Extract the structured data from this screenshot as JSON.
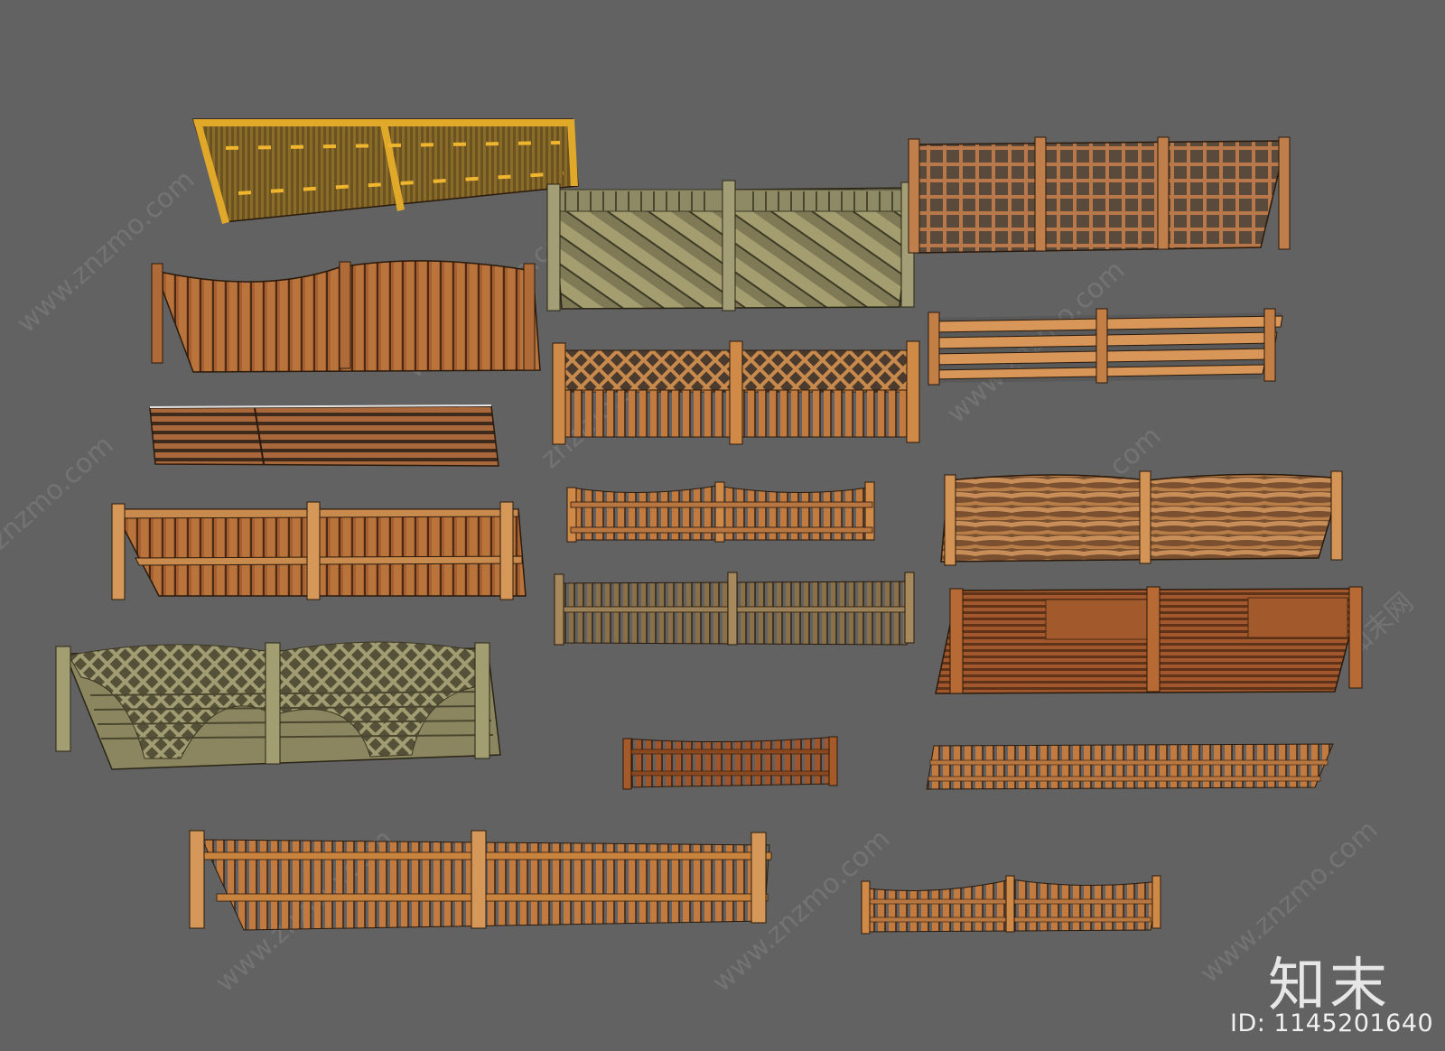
{
  "image": {
    "background": "#626262",
    "content": "sketchup-style collection of 18 wooden fence panel models"
  },
  "watermark": {
    "site_text": "znzmo.com",
    "site_text_www": "www.znzmo.com",
    "brand_text": "知末网",
    "logo_text": "知末",
    "id_text": "ID: 1145201640"
  },
  "colors": {
    "amber": "#c0862a",
    "amber_dark": "#8a5a1c",
    "orange_wood": "#c77a3a",
    "brown_wood": "#a35a28",
    "olive_wood": "#8c8660",
    "yellow_frame": "#e1a92a",
    "outline": "#2a1a0c"
  },
  "fences": [
    {
      "id": "bamboo-panel",
      "style": "vertical-slats-yellow-frame"
    },
    {
      "id": "diagonal-board",
      "style": "diagonal-boards-olive"
    },
    {
      "id": "square-lattice",
      "style": "grid-lattice"
    },
    {
      "id": "curved-top-vertical",
      "style": "vertical-boards-curved-top"
    },
    {
      "id": "lattice-top-picket",
      "style": "lattice-top-with-vertical-pickets"
    },
    {
      "id": "horizontal-rail",
      "style": "horizontal-rails"
    },
    {
      "id": "horizontal-slat",
      "style": "horizontal-slats"
    },
    {
      "id": "scalloped-picket",
      "style": "scalloped-pickets"
    },
    {
      "id": "woven-wood",
      "style": "woven-horizontal-boards"
    },
    {
      "id": "boxed-vertical",
      "style": "vertical-boards-with-posts"
    },
    {
      "id": "round-pointed",
      "style": "round-pointed-stakes"
    },
    {
      "id": "louvered",
      "style": "louvered-horizontal-slats"
    },
    {
      "id": "sunburst-lattice",
      "style": "arched-lattice-olive"
    },
    {
      "id": "short-picket",
      "style": "short-dark-pickets"
    },
    {
      "id": "long-picket",
      "style": "long-low-pickets"
    },
    {
      "id": "tall-picket",
      "style": "tall-spaced-pickets"
    },
    {
      "id": "curved-picket",
      "style": "curved-low-pickets"
    }
  ]
}
